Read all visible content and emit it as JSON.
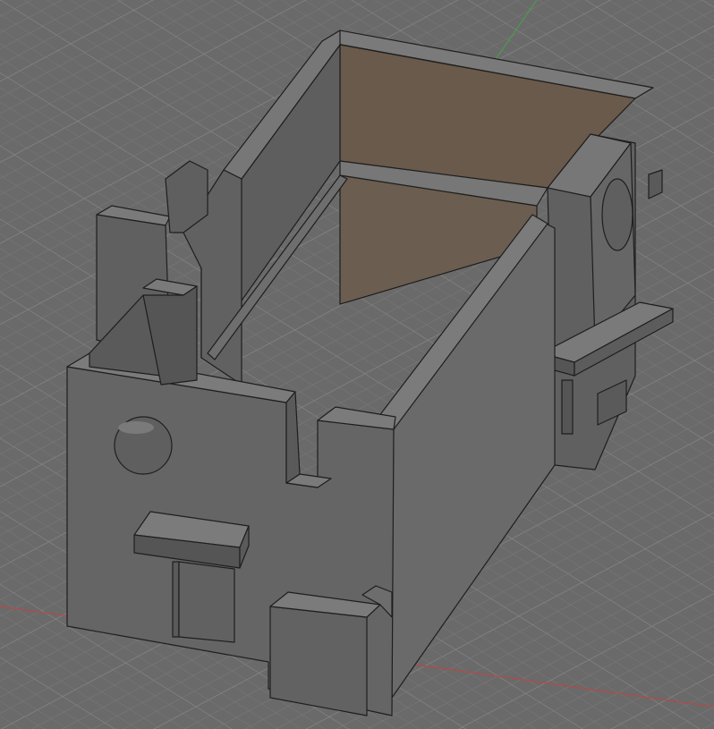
{
  "viewport": {
    "background": "#6a6a6a",
    "grid_minor_color": "#7a7a7a",
    "grid_major_color": "#858585",
    "axis_x_color": "#b24a4a",
    "axis_y_color": "#4aa24a"
  },
  "model": {
    "face_front": "#656565",
    "face_side": "#5a5a5a",
    "face_top": "#7a7a7a",
    "face_dark": "#4e4e4e",
    "inner_back_wall": "#6a5a4c",
    "edge_color": "#1e1e1e"
  }
}
